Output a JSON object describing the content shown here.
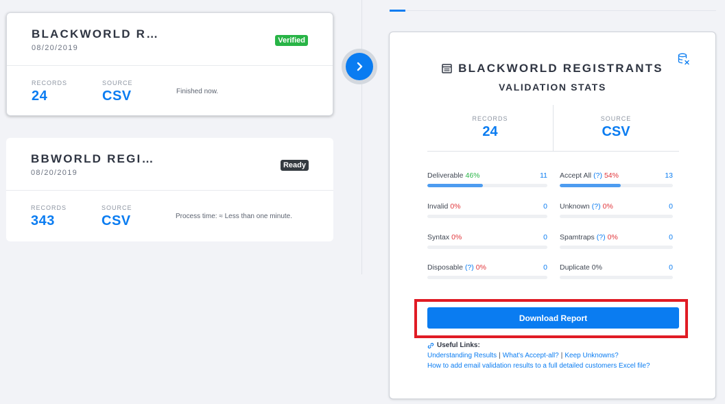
{
  "lists": [
    {
      "title": "BLACKWORLD R…",
      "date": "08/20/2019",
      "badge": "Verified",
      "records_label": "RECORDS",
      "records": "24",
      "source_label": "SOURCE",
      "source": "CSV",
      "note": "Finished now."
    },
    {
      "title": "BBWORLD REGI…",
      "date": "08/20/2019",
      "badge": "Ready",
      "records_label": "RECORDS",
      "records": "343",
      "source_label": "SOURCE",
      "source": "CSV",
      "note": "Process time: ≈ Less than one minute."
    }
  ],
  "panel": {
    "title": "BLACKWORLD REGISTRANTS",
    "subtitle": "VALIDATION STATS",
    "records_label": "RECORDS",
    "records": "24",
    "source_label": "SOURCE",
    "source": "CSV",
    "help_mark": "(?)",
    "metrics": [
      {
        "label": "Deliverable",
        "help": false,
        "pct": "46%",
        "pct_color": "green",
        "count": "11",
        "fill": 0.46
      },
      {
        "label": "Accept All",
        "help": true,
        "pct": "54%",
        "pct_color": "red",
        "count": "13",
        "fill": 0.54
      },
      {
        "label": "Invalid",
        "help": false,
        "pct": "0%",
        "pct_color": "red",
        "count": "0",
        "fill": 0
      },
      {
        "label": "Unknown",
        "help": true,
        "pct": "0%",
        "pct_color": "red",
        "count": "0",
        "fill": 0
      },
      {
        "label": "Syntax",
        "help": false,
        "pct": "0%",
        "pct_color": "red",
        "count": "0",
        "fill": 0
      },
      {
        "label": "Spamtraps",
        "help": true,
        "pct": "0%",
        "pct_color": "red",
        "count": "0",
        "fill": 0
      },
      {
        "label": "Disposable",
        "help": true,
        "pct": "0%",
        "pct_color": "red",
        "count": "0",
        "fill": 0
      },
      {
        "label": "Duplicate",
        "help": false,
        "pct": "0%",
        "pct_color": "gray",
        "count": "0",
        "fill": 0
      }
    ],
    "download_label": "Download Report",
    "links_heading": "Useful Links:",
    "links": {
      "understanding": "Understanding Results",
      "separator": "|",
      "accept_all": "What's Accept-all?",
      "keep_unknowns": "Keep Unknowns?",
      "excel": "How to add email validation results to a full detailed customers Excel file?"
    }
  },
  "colors": {
    "accent": "#0a7cf1",
    "verified": "#28b446",
    "ready": "#343a40",
    "highlight": "#e01b24"
  }
}
